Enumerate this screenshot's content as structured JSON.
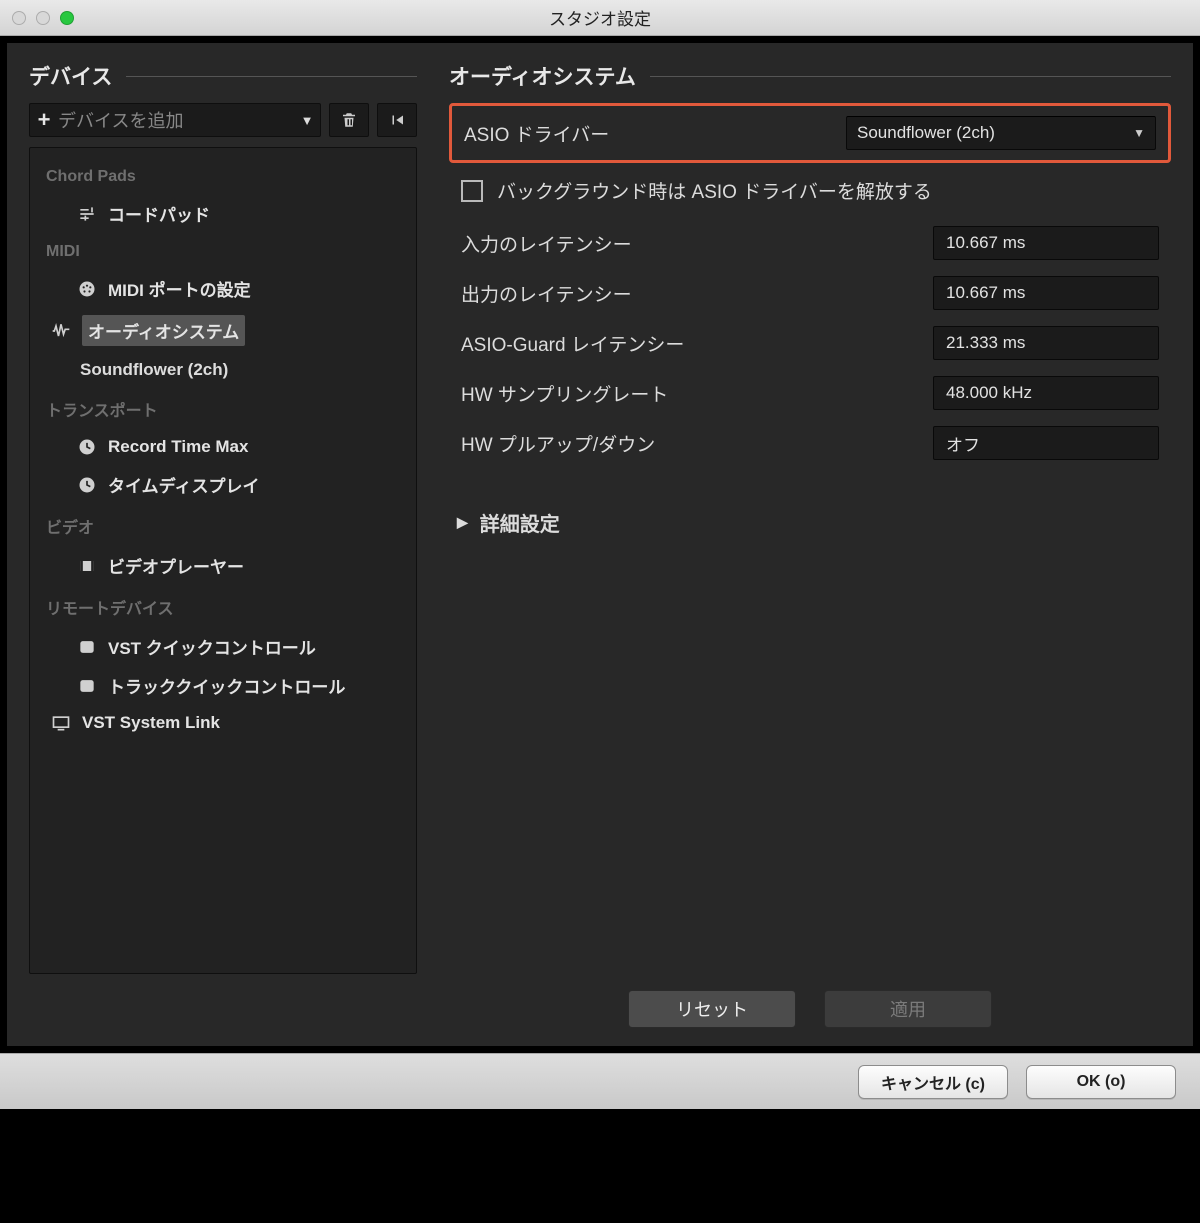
{
  "window": {
    "title": "スタジオ設定"
  },
  "left": {
    "heading": "デバイス",
    "add_label": "デバイスを追加",
    "groups": {
      "chord_pads": "Chord Pads",
      "midi": "MIDI",
      "transport": "トランスポート",
      "video": "ビデオ",
      "remote": "リモートデバイス"
    },
    "items": {
      "chord_pad": "コードパッド",
      "midi_ports": "MIDI ポートの設定",
      "audio_system": "オーディオシステム",
      "audio_child": "Soundflower (2ch)",
      "record_time": "Record Time Max",
      "time_display": "タイムディスプレイ",
      "video_player": "ビデオプレーヤー",
      "vst_quick": "VST クイックコントロール",
      "track_quick": "トラッククイックコントロール",
      "vst_system_link": "VST System Link"
    }
  },
  "right": {
    "heading": "オーディオシステム",
    "driver_label": "ASIO ドライバー",
    "driver_value": "Soundflower (2ch)",
    "release_bg": "バックグラウンド時は ASIO ドライバーを解放する",
    "rows": {
      "in_latency": {
        "label": "入力のレイテンシー",
        "value": "10.667 ms"
      },
      "out_latency": {
        "label": "出力のレイテンシー",
        "value": "10.667 ms"
      },
      "guard": {
        "label": "ASIO-Guard レイテンシー",
        "value": "21.333 ms"
      },
      "hw_rate": {
        "label": "HW サンプリングレート",
        "value": "48.000 kHz"
      },
      "hw_pull": {
        "label": "HW プルアップ/ダウン",
        "value": "オフ"
      }
    },
    "advanced": "詳細設定",
    "reset": "リセット",
    "apply": "適用"
  },
  "footer": {
    "cancel": "キャンセル (c)",
    "ok": "OK (o)"
  }
}
